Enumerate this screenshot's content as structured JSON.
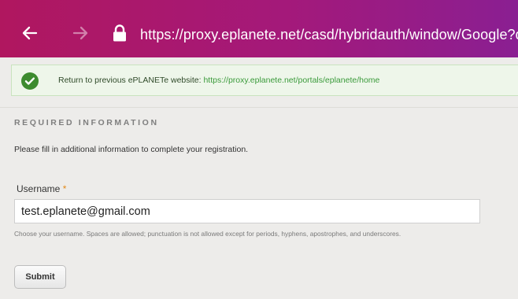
{
  "browser": {
    "url": "https://proxy.eplanete.net/casd/hybridauth/window/Google?des",
    "back_icon": "arrow-left-icon",
    "forward_icon": "arrow-right-icon",
    "lock_icon": "lock-icon"
  },
  "notice": {
    "icon": "check-circle-icon",
    "prefix": "Return to previous ePLANETe website: ",
    "link_text": "https://proxy.eplanete.net/portals/eplanete/home",
    "link_color": "#3a9a3a"
  },
  "form": {
    "section_title": "REQUIRED INFORMATION",
    "intro": "Please fill in additional information to complete your registration.",
    "username_label": "Username",
    "required_marker": "*",
    "username_value": "test.eplanete@gmail.com",
    "help_text": "Choose your username. Spaces are allowed; punctuation is not allowed except for periods, hyphens, apostrophes, and underscores.",
    "submit_label": "Submit"
  },
  "colors": {
    "topbar_start": "#b0175f",
    "topbar_end": "#8a1f92",
    "success_green": "#3d8b2f",
    "required": "#e2891a"
  }
}
